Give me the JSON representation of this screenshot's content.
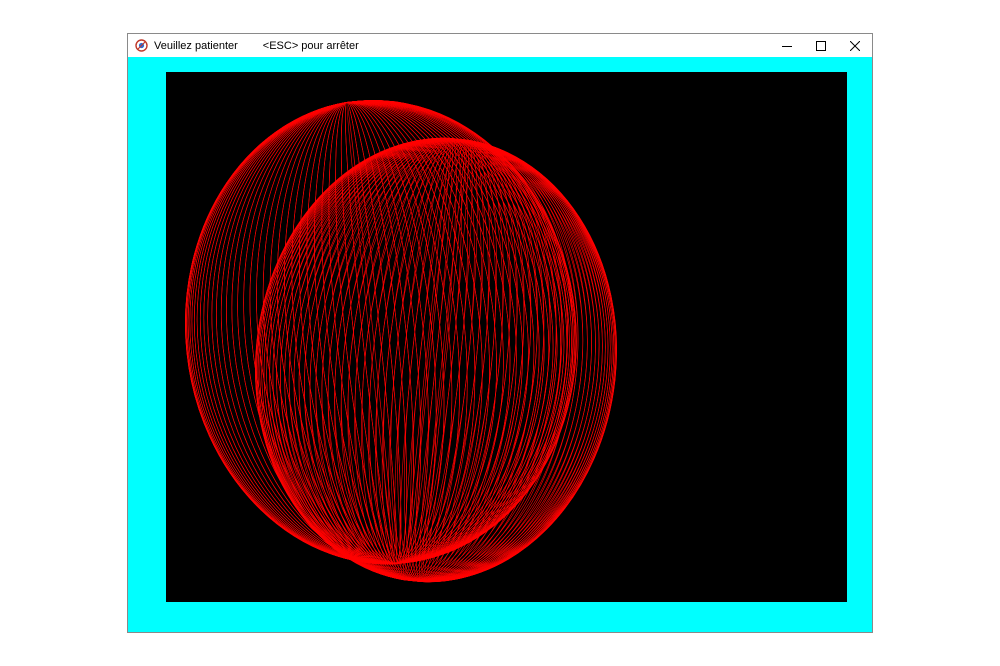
{
  "window": {
    "title": "Veuillez patienter",
    "hint": "<ESC> pour arrêter",
    "controls": {
      "minimize_icon": "minimize-icon",
      "maximize_icon": "maximize-icon",
      "close_icon": "close-icon"
    },
    "app_icon": "app-icon"
  },
  "colors": {
    "frame_background": "#00ffff",
    "canvas_background": "#000000",
    "drawing_color": "#ff0000",
    "titlebar_background": "#ffffff"
  }
}
